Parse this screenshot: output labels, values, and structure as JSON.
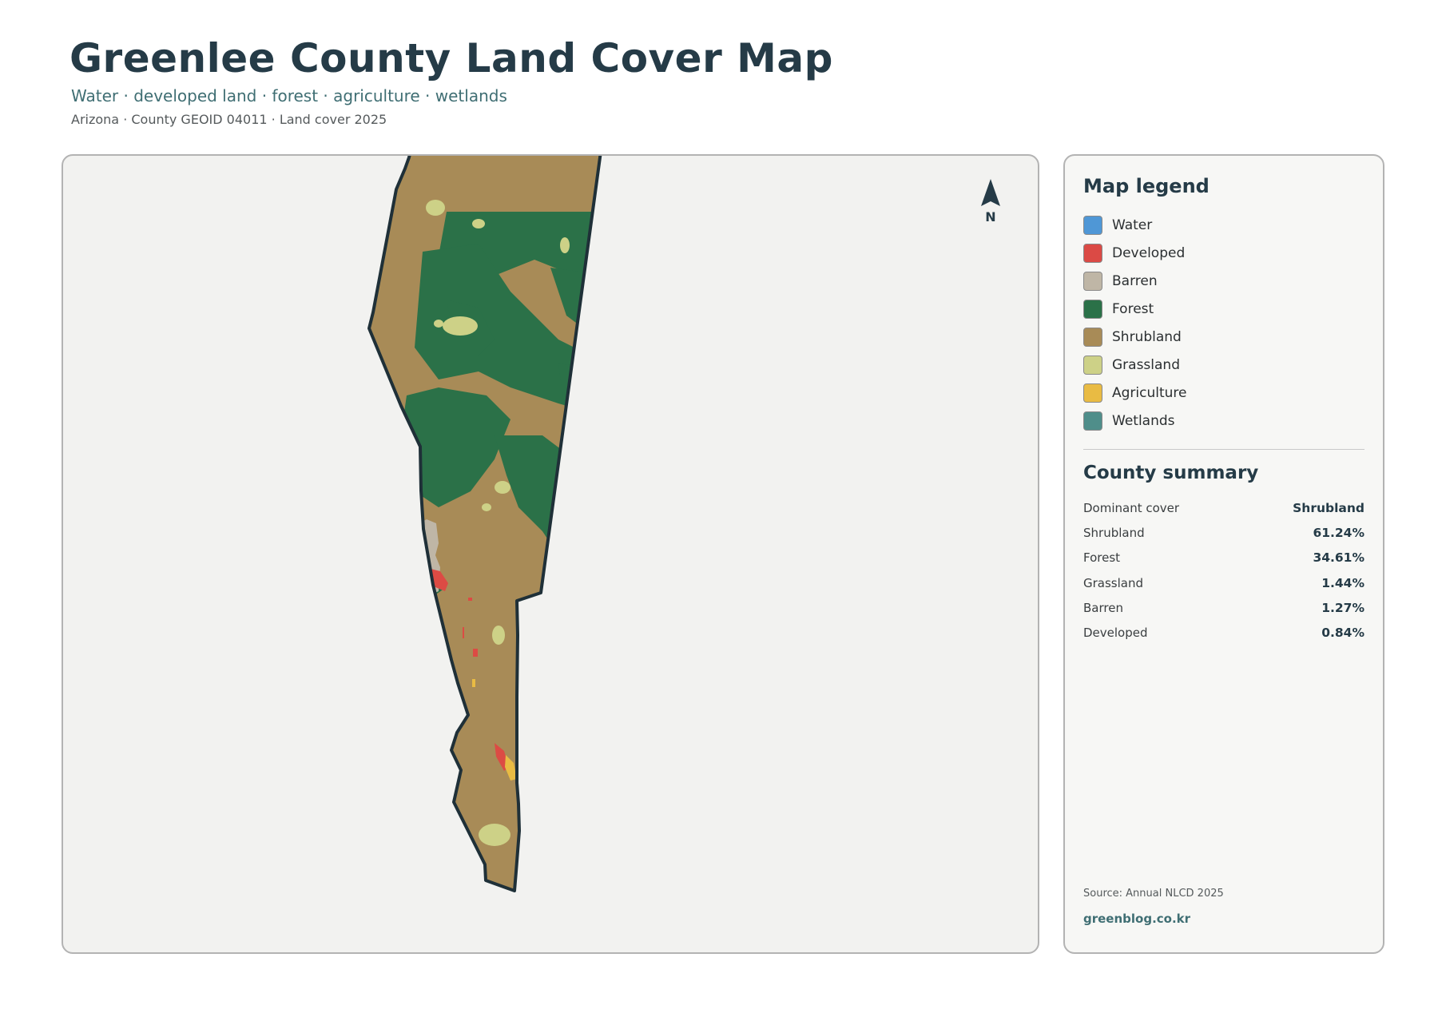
{
  "header": {
    "title": "Greenlee County Land Cover Map",
    "subtitle": "Water · developed land · forest · agriculture · wetlands",
    "meta": "Arizona · County GEOID 04011 · Land cover 2025"
  },
  "map": {
    "north_label": "N",
    "north_icon": "north-arrow-icon",
    "colors": {
      "forest": "#2b7148",
      "shrubland": "#a88b57",
      "barren": "#bfb6a6",
      "grassland": "#cdd187",
      "developed": "#dc4b44",
      "agriculture": "#e9bb43",
      "boundary": "#1f3038"
    }
  },
  "legend": {
    "title": "Map legend",
    "items": [
      {
        "label": "Water",
        "color": "#4f97d6"
      },
      {
        "label": "Developed",
        "color": "#db4a45"
      },
      {
        "label": "Barren",
        "color": "#bfb6a6"
      },
      {
        "label": "Forest",
        "color": "#2b7148"
      },
      {
        "label": "Shrubland",
        "color": "#a88b57"
      },
      {
        "label": "Grassland",
        "color": "#cdd187"
      },
      {
        "label": "Agriculture",
        "color": "#e9bb43"
      },
      {
        "label": "Wetlands",
        "color": "#4f8e8a"
      }
    ]
  },
  "summary": {
    "title": "County summary",
    "rows": [
      {
        "label": "Dominant cover",
        "value": "Shrubland"
      },
      {
        "label": "Shrubland",
        "value": "61.24%"
      },
      {
        "label": "Forest",
        "value": "34.61%"
      },
      {
        "label": "Grassland",
        "value": "1.44%"
      },
      {
        "label": "Barren",
        "value": "1.27%"
      },
      {
        "label": "Developed",
        "value": "0.84%"
      }
    ]
  },
  "footer": {
    "source": "Source: Annual NLCD 2025",
    "site": "greenblog.co.kr"
  }
}
